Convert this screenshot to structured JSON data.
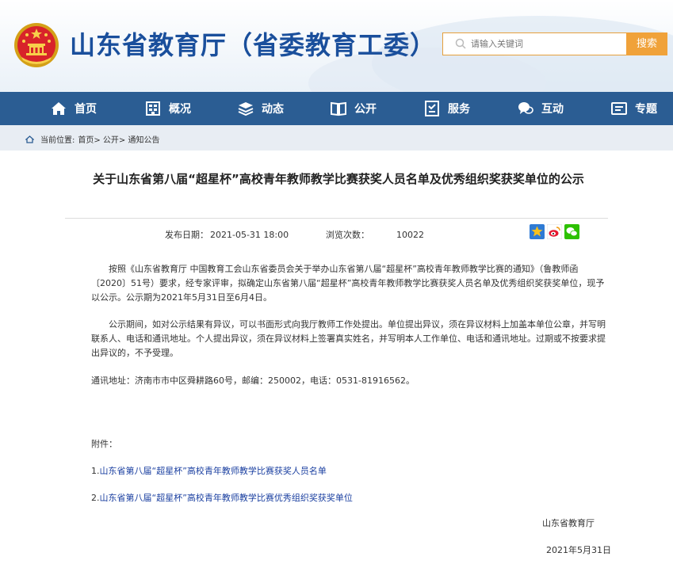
{
  "header": {
    "site_title": "山东省教育厅（省委教育工委）",
    "search_placeholder": "请输入关键词",
    "search_button": "搜索"
  },
  "nav": {
    "items": [
      {
        "label": "首页",
        "icon": "home-icon"
      },
      {
        "label": "概况",
        "icon": "building-icon"
      },
      {
        "label": "动态",
        "icon": "layers-icon"
      },
      {
        "label": "公开",
        "icon": "book-icon"
      },
      {
        "label": "服务",
        "icon": "service-icon"
      },
      {
        "label": "互动",
        "icon": "chat-icon"
      },
      {
        "label": "专题",
        "icon": "topic-icon"
      }
    ]
  },
  "breadcrumb": {
    "prefix": "当前位置:",
    "path": "首页> 公开> 通知公告"
  },
  "article": {
    "title": "关于山东省第八届“超星杯”高校青年教师教学比赛获奖人员名单及优秀组织奖获奖单位的公示",
    "publish_label": "发布日期：",
    "publish_date": "2021-05-31 18:00",
    "views_label": "浏览次数：",
    "views": "10022",
    "paragraphs": [
      "按照《山东省教育厅 中国教育工会山东省委员会关于举办山东省第八届“超星杯”高校青年教师教学比赛的通知》（鲁教师函〔2020〕51号）要求，经专家评审，拟确定山东省第八届“超星杯”高校青年教师教学比赛获奖人员名单及优秀组织奖获奖单位，现予以公示。公示期为2021年5月31日至6月4日。",
      "公示期间，如对公示结果有异议，可以书面形式向我厅教师工作处提出。单位提出异议，须在异议材料上加盖本单位公章，并写明联系人、电话和通讯地址。个人提出异议，须在异议材料上签署真实姓名，并写明本人工作单位、电话和通讯地址。过期或不按要求提出异议的，不予受理。"
    ],
    "address": "通讯地址：济南市市中区舜耕路60号，邮编：250002，电话：0531-81916562。",
    "attachments_label": "附件：",
    "attachments": [
      {
        "num": "1.",
        "title": "山东省第八届“超星杯”高校青年教师教学比赛获奖人员名单"
      },
      {
        "num": "2.",
        "title": "山东省第八届“超星杯”高校青年教师教学比赛优秀组织奖获奖单位"
      }
    ],
    "signature": "山东省教育厅",
    "sign_date": "2021年5月31日"
  },
  "colors": {
    "brand_blue": "#1a4f9c",
    "nav_bg": "#2b5d93",
    "search_orange": "#f0a23a",
    "link_blue": "#1a3fa0"
  }
}
